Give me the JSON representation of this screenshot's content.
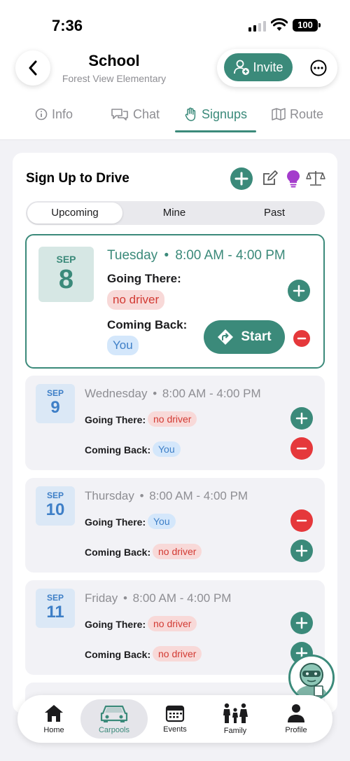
{
  "status_bar": {
    "time": "7:36",
    "battery": "100"
  },
  "header": {
    "title": "School",
    "subtitle": "Forest View Elementary",
    "invite_label": "Invite"
  },
  "tabs": [
    {
      "label": "Info"
    },
    {
      "label": "Chat"
    },
    {
      "label": "Signups"
    },
    {
      "label": "Route"
    }
  ],
  "active_tab": "Signups",
  "card": {
    "title": "Sign Up to Drive",
    "segments": [
      {
        "label": "Upcoming"
      },
      {
        "label": "Mine"
      },
      {
        "label": "Past"
      }
    ],
    "active_segment": "Upcoming"
  },
  "days": [
    {
      "month": "SEP",
      "date": "8",
      "weekday": "Tuesday",
      "separator": "•",
      "time": "8:00 AM - 4:00 PM",
      "going_label": "Going There:",
      "going_value": "no driver",
      "back_label": "Coming Back:",
      "back_value": "You",
      "start_label": "Start"
    },
    {
      "month": "SEP",
      "date": "9",
      "weekday": "Wednesday",
      "separator": "•",
      "time": "8:00 AM - 4:00 PM",
      "going_label": "Going There:",
      "going_value": "no driver",
      "back_label": "Coming Back:",
      "back_value": "You"
    },
    {
      "month": "SEP",
      "date": "10",
      "weekday": "Thursday",
      "separator": "•",
      "time": "8:00 AM - 4:00 PM",
      "going_label": "Going There:",
      "going_value": "You",
      "back_label": "Coming Back:",
      "back_value": "no driver"
    },
    {
      "month": "SEP",
      "date": "11",
      "weekday": "Friday",
      "separator": "•",
      "time": "8:00 AM - 4:00 PM",
      "going_label": "Going There:",
      "going_value": "no driver",
      "back_label": "Coming Back:",
      "back_value": "no driver"
    }
  ],
  "tabbar": [
    {
      "label": "Home",
      "icon": "home-icon"
    },
    {
      "label": "Carpools",
      "icon": "car-icon"
    },
    {
      "label": "Events",
      "icon": "calendar-icon"
    },
    {
      "label": "Family",
      "icon": "family-icon"
    },
    {
      "label": "Profile",
      "icon": "person-icon"
    }
  ],
  "active_tabbar": "Carpools",
  "colors": {
    "accent": "#3b8a7a",
    "danger": "#e5383b",
    "blue": "#3e7fc7",
    "lightbulb": "#a43ccc"
  }
}
